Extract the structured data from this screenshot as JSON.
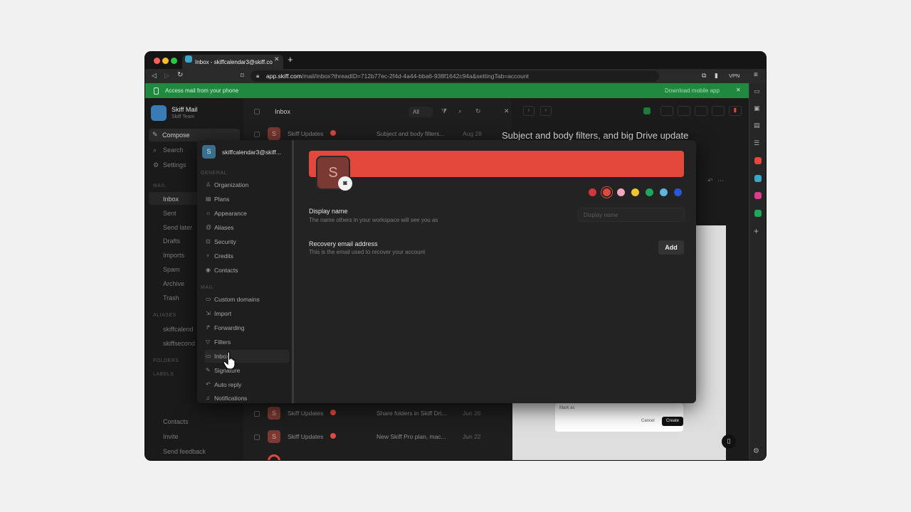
{
  "browser": {
    "tab_title": "Inbox - skiffcalendar3@skiff.co",
    "url_domain": "app.skiff.com",
    "url_path": "/mail/inbox?threadID=712b77ec-2f4d-4a44-bba6-938f1642c94a&settingTab=account",
    "vpn_label": "VPN"
  },
  "banner": {
    "text": "Access mail from your phone",
    "link": "Download mobile app"
  },
  "sidebar": {
    "app_name": "Skiff Mail",
    "workspace": "Skiff Team",
    "compose": "Compose",
    "search": "Search",
    "settings": "Settings",
    "mail_header": "MAIL",
    "items": [
      "Inbox",
      "Sent",
      "Send later",
      "Drafts",
      "Imports",
      "Spam",
      "Archive",
      "Trash"
    ],
    "aliases_header": "ALIASES",
    "aliases": [
      "skiffcalend",
      "skiffsecond"
    ],
    "folders_header": "FOLDERS",
    "labels_header": "LABELS",
    "contacts": "Contacts",
    "invite": "Invite",
    "feedback": "Send feedback"
  },
  "list": {
    "title": "Inbox",
    "filter": "All",
    "rows": [
      {
        "sender": "Skiff Updates",
        "subject": "Subject and body filters...",
        "date": "Aug 28"
      },
      {
        "sender": "Skiff Updates",
        "subject": "Share folders in Skiff Dri...",
        "date": "Jun 26"
      },
      {
        "sender": "Skiff Updates",
        "subject": "New Skiff Pro plan, mac...",
        "date": "Jun 22"
      }
    ]
  },
  "reader": {
    "subject": "Subject and body filters, and big Drive update",
    "preview_row": "Mark as",
    "preview_cancel": "Cancel",
    "preview_create": "Create"
  },
  "settings": {
    "account": "skiffcalendar3@skiff...",
    "avatar_letter": "S",
    "general_header": "GENERAL",
    "general": [
      "Organization",
      "Plans",
      "Appearance",
      "Aliases",
      "Security",
      "Credits",
      "Contacts"
    ],
    "mail_header": "MAIL",
    "mail": [
      "Custom domains",
      "Import",
      "Forwarding",
      "Filters",
      "Inbox",
      "Signature",
      "Auto reply",
      "Notifications"
    ],
    "display_name_label": "Display name",
    "display_name_desc": "The name others in your workspace will see you as",
    "display_name_placeholder": "Display name",
    "recovery_label": "Recovery email address",
    "recovery_desc": "This is the email used to recover your account",
    "add_button": "Add",
    "swatches": [
      "#d6343e",
      "#e4473b",
      "#f2a7c0",
      "#f1c232",
      "#1ea85a",
      "#5db6e0",
      "#2857d6"
    ],
    "selected_swatch": 1
  }
}
